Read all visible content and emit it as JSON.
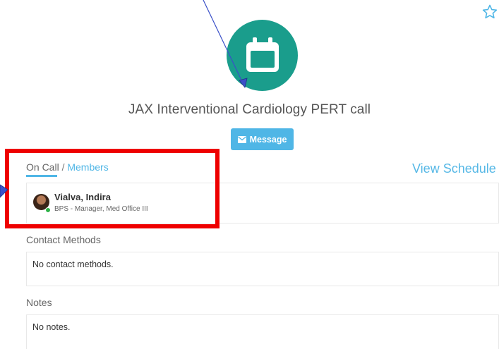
{
  "header": {
    "title": "JAX Interventional Cardiology PERT call",
    "favorite_icon": "star-icon",
    "avatar_icon": "calendar-icon",
    "avatar_color": "#1a9d8c"
  },
  "actions": {
    "message_label": "Message",
    "message_icon": "envelope-icon",
    "accent_color": "#4fb6e6"
  },
  "tabs": {
    "on_call": "On Call",
    "separator": "/",
    "members": "Members",
    "view_schedule": "View Schedule"
  },
  "on_call_member": {
    "name": "Vialva, Indira",
    "role": "BPS - Manager, Med Office III",
    "status": "online",
    "status_color": "#2fb34a"
  },
  "contact_methods": {
    "label": "Contact Methods",
    "value": "No contact methods."
  },
  "notes": {
    "label": "Notes",
    "value": "No notes."
  },
  "annotations": {
    "highlight_color": "#ee0000",
    "arrow_color": "#3a50c8"
  }
}
